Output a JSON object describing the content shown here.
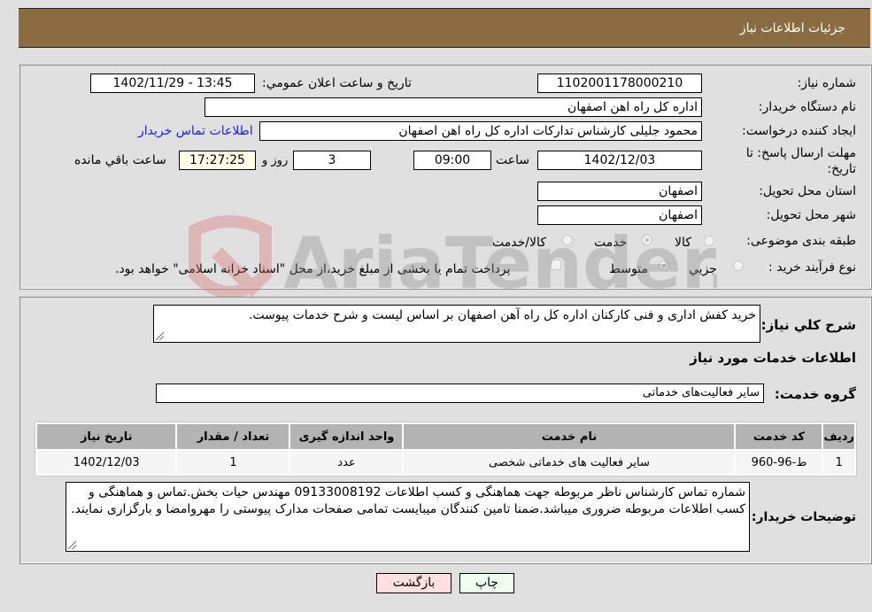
{
  "header": {
    "title": "جزئیات اطلاعات نیاز"
  },
  "form": {
    "need_number": {
      "label": "شماره نیاز:",
      "value": "1102001178000210"
    },
    "announce_datetime": {
      "label": "تاریخ و ساعت اعلان عمومي:",
      "value": "1402/11/29 - 13:45"
    },
    "buyer_org": {
      "label": "نام دستگاه خریدار:",
      "value": "اداره کل راه اهن اصفهان"
    },
    "requester": {
      "label": "ایجاد کننده درخواست:",
      "value": "محمود جلیلی کارشناس تدارکات اداره کل راه اهن اصفهان"
    },
    "buyer_contact_link": "اطلاعات تماس خریدار",
    "deadline": {
      "label": "مهلت ارسال پاسخ: تا تاریخ:",
      "date": "1402/12/03",
      "time_label": "ساعت",
      "time": "09:00",
      "days": "3",
      "days_label": "روز و",
      "remaining": "17:27:25",
      "remaining_label": "ساعت باقي مانده"
    },
    "province": {
      "label": "استان محل تحویل:",
      "value": "اصفهان"
    },
    "city": {
      "label": "شهر محل تحویل:",
      "value": "اصفهان"
    },
    "category": {
      "label": "طبقه بندی موضوعی:",
      "options": [
        {
          "label": "کالا",
          "selected": false
        },
        {
          "label": "خدمت",
          "selected": true
        },
        {
          "label": "کالا/خدمت",
          "selected": false
        }
      ]
    },
    "purchase_type": {
      "label": "نوع فرآیند خرید :",
      "options": [
        {
          "label": "جزيي",
          "selected": false
        },
        {
          "label": "متوسط",
          "selected": true
        }
      ],
      "treasury_note": "پرداخت تمام یا بخشی از مبلغ خرید،از محل \"اسناد خزانه اسلامی\" خواهد بود.",
      "treasury_checked": false
    }
  },
  "details": {
    "summary_label": "شرح کلي نياز:",
    "summary": "خرید کفش اداری و فنی کارکنان اداره کل راه آهن اصفهان بر اساس لیست و شرح خدمات پیوست.",
    "services_heading": "اطلاعات خدمات مورد نياز",
    "service_group_label": "گروه خدمت:",
    "service_group": "سایر فعالیت‌های خدماتی",
    "table": {
      "headers": [
        "ردیف",
        "کد خدمت",
        "نام خدمت",
        "واحد اندازه گیری",
        "تعداد / مقدار",
        "تاریخ نیاز"
      ],
      "rows": [
        [
          "1",
          "ط-96-960",
          "سایر فعالیت های خدماتی شخصی",
          "عدد",
          "1",
          "1402/12/03"
        ]
      ]
    },
    "buyer_notes_label": "توضیحات خریدار:",
    "buyer_notes": "شماره تماس کارشناس ناظر  مربوطه جهت هماهنگی و کسب اطلاعات 09133008192 مهندس حیات بخش.تماس و هماهنگی و کسب اطلاعات مربوطه ضروری میباشد.ضمنا تامین کنندگان میبایست تمامی صفحات مدارک پیوستی را مهروامضا و بارگزاری نمایند."
  },
  "buttons": {
    "print": "چاپ",
    "back": "بازگشت"
  },
  "watermark": "AriaTender.neT"
}
